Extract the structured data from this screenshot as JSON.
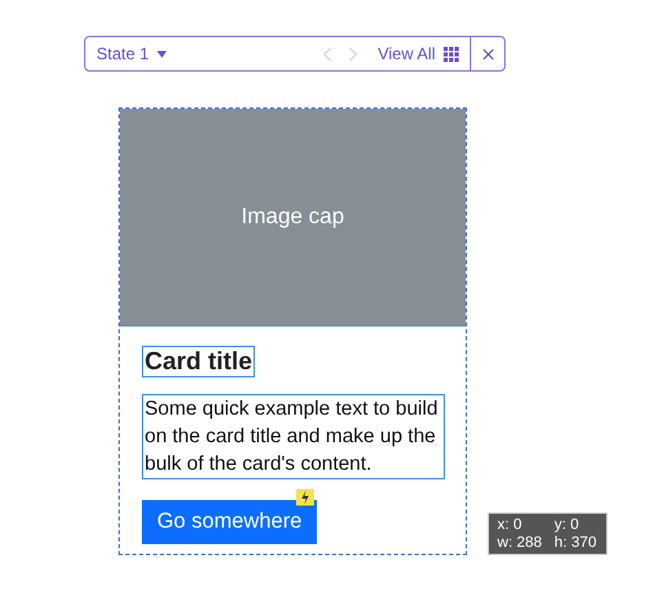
{
  "toolbar": {
    "state": "State 1",
    "prev": {
      "disabled": true
    },
    "next": {
      "disabled": true
    },
    "view_all": "View All"
  },
  "card": {
    "image_cap": "Image cap",
    "title": "Card title",
    "text": "Some quick example text to build on the card title and make up the bulk of the card's content.",
    "button": "Go somewhere"
  },
  "info": [
    "x: 0",
    "y: 0",
    "w: 288",
    "h: 370"
  ]
}
